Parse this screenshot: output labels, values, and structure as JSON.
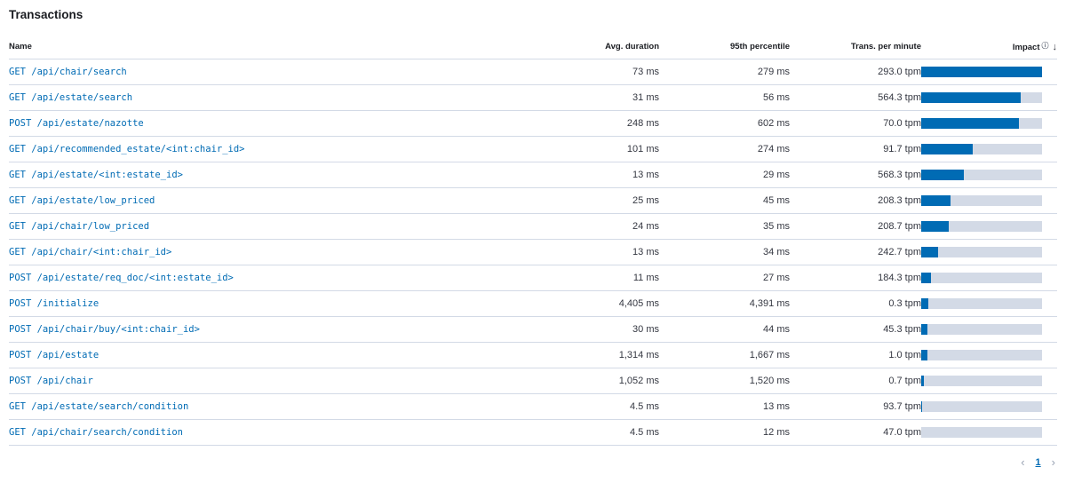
{
  "title": "Transactions",
  "columns": {
    "name": "Name",
    "avg_duration": "Avg. duration",
    "p95": "95th percentile",
    "tpm": "Trans. per minute",
    "impact": "Impact",
    "impact_help_icon": "help-icon",
    "sort_icon": "arrow-down-icon"
  },
  "rows": [
    {
      "name": "GET /api/chair/search",
      "avg": "73 ms",
      "p95": "279 ms",
      "tpm": "293.0 tpm",
      "impact": 100
    },
    {
      "name": "GET /api/estate/search",
      "avg": "31 ms",
      "p95": "56 ms",
      "tpm": "564.3 tpm",
      "impact": 82
    },
    {
      "name": "POST /api/estate/nazotte",
      "avg": "248 ms",
      "p95": "602 ms",
      "tpm": "70.0 tpm",
      "impact": 81
    },
    {
      "name": "GET /api/recommended_estate/<int:chair_id>",
      "avg": "101 ms",
      "p95": "274 ms",
      "tpm": "91.7 tpm",
      "impact": 43
    },
    {
      "name": "GET /api/estate/<int:estate_id>",
      "avg": "13 ms",
      "p95": "29 ms",
      "tpm": "568.3 tpm",
      "impact": 35
    },
    {
      "name": "GET /api/estate/low_priced",
      "avg": "25 ms",
      "p95": "45 ms",
      "tpm": "208.3 tpm",
      "impact": 24
    },
    {
      "name": "GET /api/chair/low_priced",
      "avg": "24 ms",
      "p95": "35 ms",
      "tpm": "208.7 tpm",
      "impact": 23
    },
    {
      "name": "GET /api/chair/<int:chair_id>",
      "avg": "13 ms",
      "p95": "34 ms",
      "tpm": "242.7 tpm",
      "impact": 14
    },
    {
      "name": "POST /api/estate/req_doc/<int:estate_id>",
      "avg": "11 ms",
      "p95": "27 ms",
      "tpm": "184.3 tpm",
      "impact": 8
    },
    {
      "name": "POST /initialize",
      "avg": "4,405 ms",
      "p95": "4,391 ms",
      "tpm": "0.3 tpm",
      "impact": 6
    },
    {
      "name": "POST /api/chair/buy/<int:chair_id>",
      "avg": "30 ms",
      "p95": "44 ms",
      "tpm": "45.3 tpm",
      "impact": 5
    },
    {
      "name": "POST /api/estate",
      "avg": "1,314 ms",
      "p95": "1,667 ms",
      "tpm": "1.0 tpm",
      "impact": 5
    },
    {
      "name": "POST /api/chair",
      "avg": "1,052 ms",
      "p95": "1,520 ms",
      "tpm": "0.7 tpm",
      "impact": 2
    },
    {
      "name": "GET /api/estate/search/condition",
      "avg": "4.5 ms",
      "p95": "13 ms",
      "tpm": "93.7 tpm",
      "impact": 1
    },
    {
      "name": "GET /api/chair/search/condition",
      "avg": "4.5 ms",
      "p95": "12 ms",
      "tpm": "47.0 tpm",
      "impact": 0
    }
  ],
  "pagination": {
    "prev_icon": "chevron-left-icon",
    "current_page": "1",
    "next_icon": "chevron-right-icon"
  },
  "colors": {
    "link": "#006bb4",
    "impact_bar": "#006bb4",
    "impact_track": "#d3dae6",
    "border": "#d3dae6"
  }
}
